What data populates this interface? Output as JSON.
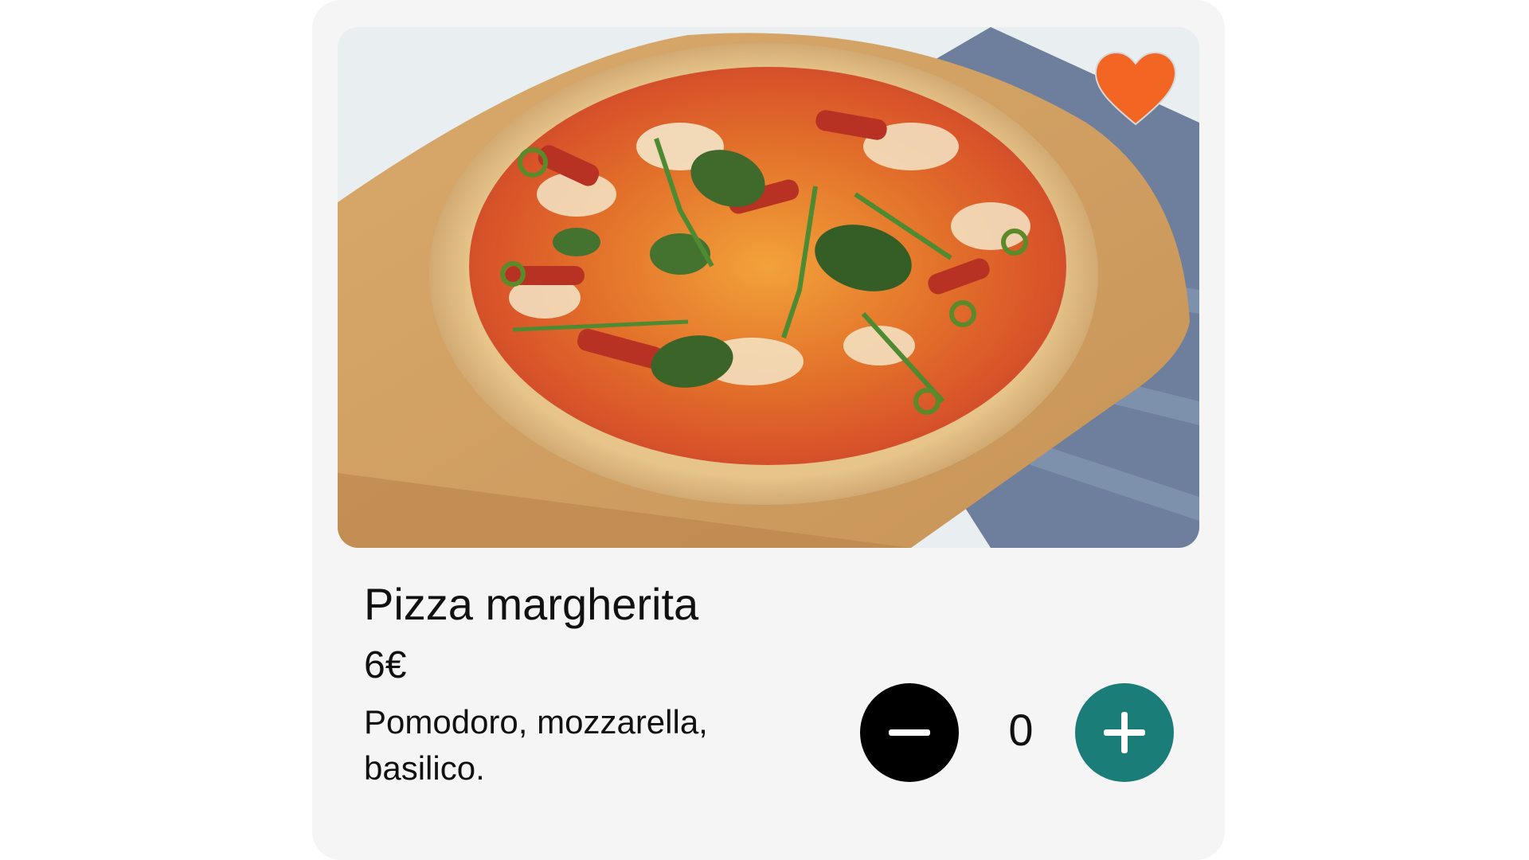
{
  "product": {
    "name": "Pizza margherita",
    "price": "6€",
    "description": "Pomodoro, mozzarella, basilico.",
    "image_icon": "pizza-photo",
    "favorite": true,
    "favorite_color": "#f26522"
  },
  "quantity": {
    "value": "0",
    "decrease_icon": "minus-icon",
    "increase_icon": "plus-icon",
    "decrease_color": "#000000",
    "increase_color": "#1a7d78"
  }
}
